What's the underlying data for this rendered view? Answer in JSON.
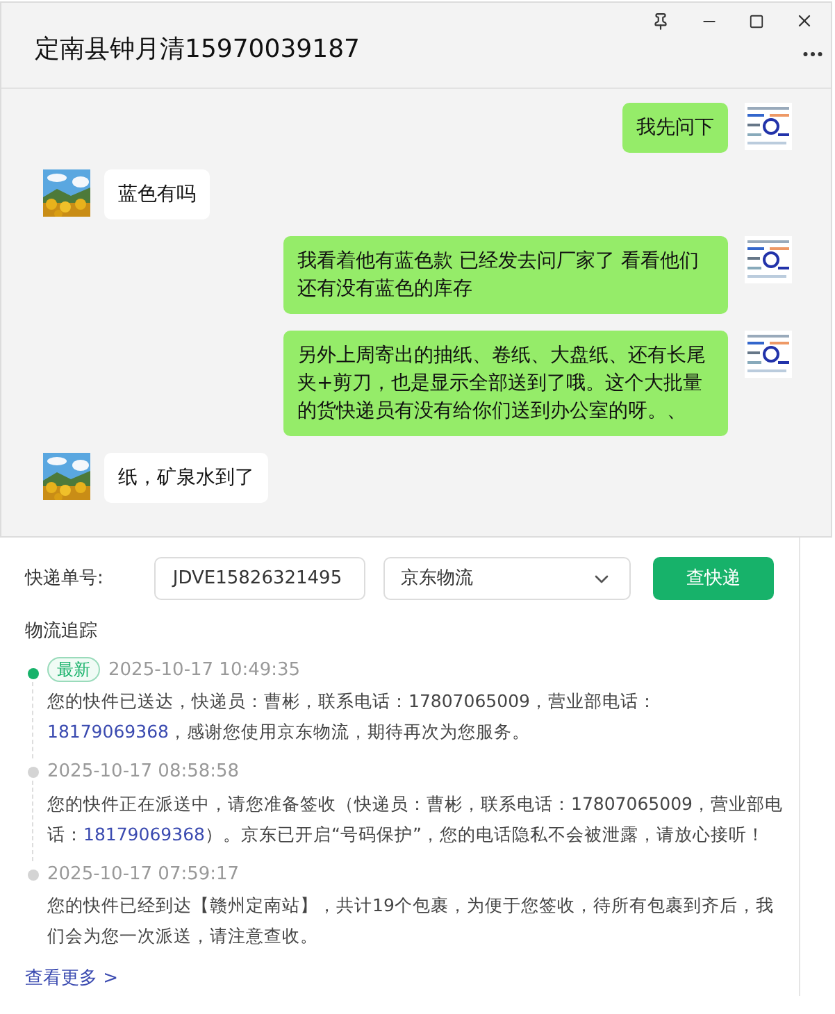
{
  "window": {
    "title": "定南县钟月清15970039187"
  },
  "messages": [
    {
      "kind": "self",
      "text": "我先问下"
    },
    {
      "kind": "other",
      "text": "蓝色有吗"
    },
    {
      "kind": "self",
      "text": "我看着他有蓝色款  已经发去问厂家了  看看他们还有没有蓝色的库存"
    },
    {
      "kind": "self",
      "text": "另外上周寄出的抽纸、卷纸、大盘纸、还有长尾夹+剪刀，也是显示全部送到了哦。这个大批量的货快递员有没有给你们送到办公室的呀。、"
    },
    {
      "kind": "other",
      "text": "纸，矿泉水到了"
    }
  ],
  "tracking": {
    "label": "快递单号:",
    "number": "JDVE15826321495",
    "carrier": "京东物流",
    "button": "查快递",
    "heading": "物流追踪",
    "events": [
      {
        "current": true,
        "badge": "最新",
        "time": "2025-10-17 10:49:35",
        "before": "您的快件已送达，快递员：曹彬，联系电话：17807065009，营业部电话：",
        "phone": "18179069368",
        "after": "，感谢您使用京东物流，期待再次为您服务。"
      },
      {
        "current": false,
        "time": "2025-10-17 08:58:58",
        "before": "您的快件正在派送中，请您准备签收（快递员：曹彬，联系电话：17807065009，营业部电话：",
        "phone": "18179069368",
        "after": "）。京东已开启“号码保护”，您的电话隐私不会被泄露，请放心接听！"
      },
      {
        "current": false,
        "time": "2025-10-17 07:59:17",
        "before": "您的快件已经到达【赣州定南站】，共计19个包裹，为便于您签收，待所有包裹到齐后，我们会为您一次派送，请注意查收。"
      }
    ],
    "more": "查看更多 >"
  }
}
